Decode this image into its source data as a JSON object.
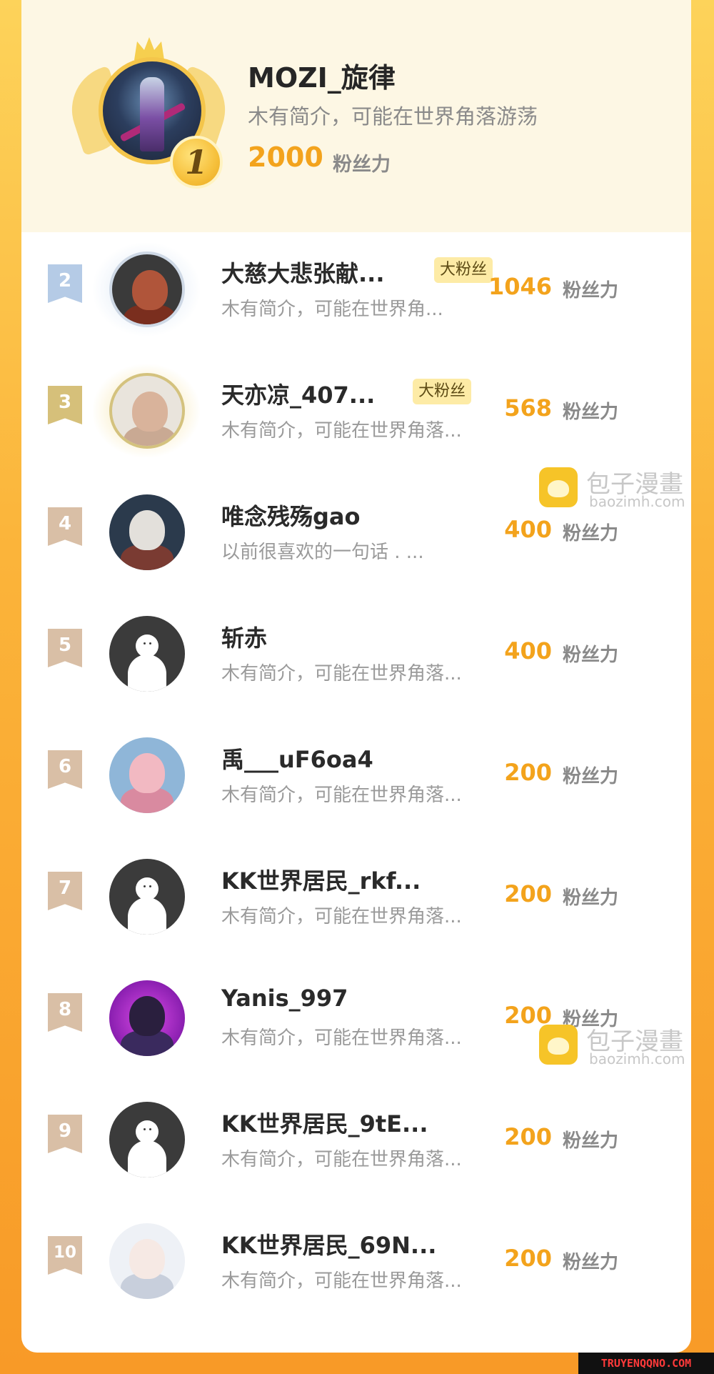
{
  "top_ranked": {
    "rank": "1",
    "name": "MOZI_旋律",
    "bio": "木有简介，可能在世界角落游荡",
    "score": "2000",
    "score_unit": "粉丝力"
  },
  "list": [
    {
      "rank": "2",
      "name": "大慈大悲张献...",
      "badge": "大粉丝",
      "bio": "木有简介，可能在世界角...",
      "score": "1046",
      "score_unit": "粉丝力"
    },
    {
      "rank": "3",
      "name": "天亦凉_407...",
      "badge": "大粉丝",
      "bio": "木有简介，可能在世界角落...",
      "score": "568",
      "score_unit": "粉丝力"
    },
    {
      "rank": "4",
      "name": "唯念残殇gao",
      "bio": "以前很喜欢的一句话 . ...",
      "score": "400",
      "score_unit": "粉丝力"
    },
    {
      "rank": "5",
      "name": "斩赤",
      "bio": "木有简介，可能在世界角落...",
      "score": "400",
      "score_unit": "粉丝力"
    },
    {
      "rank": "6",
      "name": "禹___uF6oa4",
      "bio": "木有简介，可能在世界角落...",
      "score": "200",
      "score_unit": "粉丝力"
    },
    {
      "rank": "7",
      "name": "KK世界居民_rkf...",
      "bio": "木有简介，可能在世界角落...",
      "score": "200",
      "score_unit": "粉丝力"
    },
    {
      "rank": "8",
      "name": "Yanis_997",
      "bio": "木有简介，可能在世界角落...",
      "score": "200",
      "score_unit": "粉丝力"
    },
    {
      "rank": "9",
      "name": "KK世界居民_9tE...",
      "bio": "木有简介，可能在世界角落...",
      "score": "200",
      "score_unit": "粉丝力"
    },
    {
      "rank": "10",
      "name": "KK世界居民_69N...",
      "bio": "木有简介，可能在世界角落...",
      "score": "200",
      "score_unit": "粉丝力"
    }
  ],
  "watermark": {
    "title": "包子漫畫",
    "sub": "baozimh.com"
  },
  "corner_logo": "TRUYENQQNO.COM"
}
